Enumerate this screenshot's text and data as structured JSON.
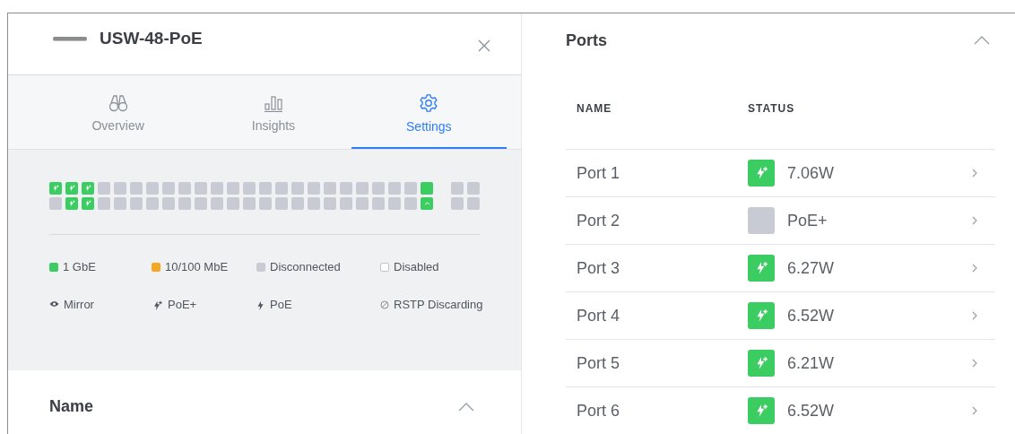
{
  "device": {
    "name": "USW-48-PoE"
  },
  "tabs": [
    {
      "label": "Overview",
      "selected": false
    },
    {
      "label": "Insights",
      "selected": false
    },
    {
      "label": "Settings",
      "selected": true
    }
  ],
  "port_map": {
    "rows": [
      [
        {
          "kind": "poe_plus"
        },
        {
          "kind": "poe_plus"
        },
        {
          "kind": "poe_plus"
        },
        {
          "kind": "disconnected"
        },
        {
          "kind": "disconnected"
        },
        {
          "kind": "disconnected"
        },
        {
          "kind": "disconnected"
        },
        {
          "kind": "disconnected"
        },
        {
          "kind": "disconnected"
        },
        {
          "kind": "disconnected"
        },
        {
          "kind": "disconnected"
        },
        {
          "kind": "disconnected"
        },
        {
          "kind": "disconnected"
        },
        {
          "kind": "disconnected"
        },
        {
          "kind": "disconnected"
        },
        {
          "kind": "disconnected"
        },
        {
          "kind": "disconnected"
        },
        {
          "kind": "disconnected"
        },
        {
          "kind": "disconnected"
        },
        {
          "kind": "disconnected"
        },
        {
          "kind": "disconnected"
        },
        {
          "kind": "disconnected"
        },
        {
          "kind": "disconnected"
        },
        {
          "kind": "link"
        }
      ],
      [
        {
          "kind": "disconnected"
        },
        {
          "kind": "poe_plus"
        },
        {
          "kind": "poe_plus"
        },
        {
          "kind": "disconnected"
        },
        {
          "kind": "disconnected"
        },
        {
          "kind": "disconnected"
        },
        {
          "kind": "disconnected"
        },
        {
          "kind": "disconnected"
        },
        {
          "kind": "disconnected"
        },
        {
          "kind": "disconnected"
        },
        {
          "kind": "disconnected"
        },
        {
          "kind": "disconnected"
        },
        {
          "kind": "disconnected"
        },
        {
          "kind": "disconnected"
        },
        {
          "kind": "disconnected"
        },
        {
          "kind": "disconnected"
        },
        {
          "kind": "disconnected"
        },
        {
          "kind": "disconnected"
        },
        {
          "kind": "disconnected"
        },
        {
          "kind": "disconnected"
        },
        {
          "kind": "disconnected"
        },
        {
          "kind": "disconnected"
        },
        {
          "kind": "disconnected"
        },
        {
          "kind": "uplink"
        }
      ]
    ],
    "sfp_rows": [
      [
        {
          "kind": "disconnected"
        },
        {
          "kind": "disconnected"
        }
      ],
      [
        {
          "kind": "disconnected"
        },
        {
          "kind": "disconnected"
        }
      ]
    ]
  },
  "legend": [
    [
      {
        "kind": "filled",
        "label": "1 GbE",
        "color": "#3bcd62"
      },
      {
        "kind": "filled",
        "label": "10/100 MbE",
        "color": "#f5a623"
      },
      {
        "kind": "filled",
        "label": "Disconnected",
        "color": "#c8cbd3"
      },
      {
        "kind": "outline",
        "label": "Disabled"
      }
    ],
    [
      {
        "kind": "eye",
        "label": "Mirror"
      },
      {
        "kind": "bolt_plus",
        "label": "PoE+"
      },
      {
        "kind": "bolt",
        "label": "PoE"
      },
      {
        "kind": "blocked",
        "label": "RSTP Discarding"
      }
    ]
  ],
  "name_section": {
    "title": "Name",
    "expanded": true
  },
  "ports": {
    "title": "Ports",
    "expanded": true,
    "columns": [
      "NAME",
      "STATUS"
    ],
    "rows": [
      {
        "name": "Port 1",
        "kind": "poe",
        "status": "7.06W"
      },
      {
        "name": "Port 2",
        "kind": "off",
        "status": "PoE+"
      },
      {
        "name": "Port 3",
        "kind": "poe",
        "status": "6.27W"
      },
      {
        "name": "Port 4",
        "kind": "poe",
        "status": "6.52W"
      },
      {
        "name": "Port 5",
        "kind": "poe",
        "status": "6.21W"
      },
      {
        "name": "Port 6",
        "kind": "poe",
        "status": "6.52W"
      }
    ]
  }
}
